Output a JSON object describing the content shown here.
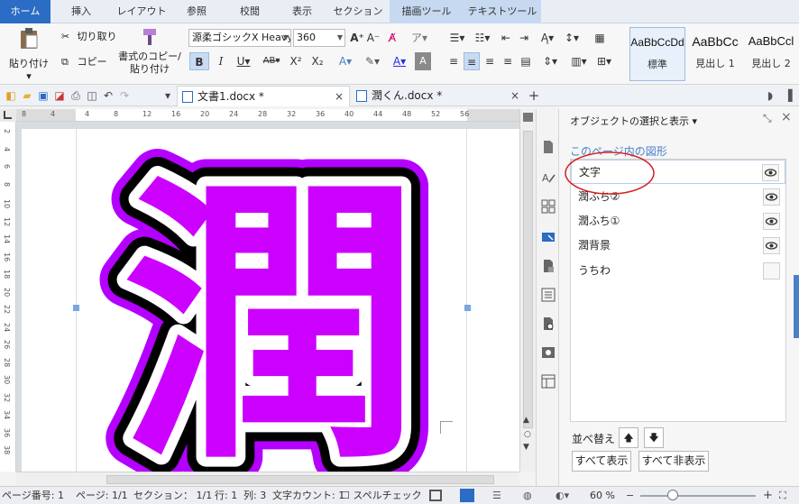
{
  "tabs": [
    {
      "label": "ホーム",
      "active": true
    },
    {
      "label": "挿入"
    },
    {
      "label": "レイアウト"
    },
    {
      "label": "参照"
    },
    {
      "label": "校閲"
    },
    {
      "label": "表示"
    },
    {
      "label": "セクション"
    },
    {
      "label": "描画ツール",
      "contextual": true
    },
    {
      "label": "テキストツール",
      "contextual": true
    }
  ],
  "ribbon": {
    "paste": "貼り付け",
    "cut": "切り取り",
    "copy": "コピー",
    "format_painter_line1": "書式のコピー/",
    "format_painter_line2": "貼り付け",
    "font_name": "源柔ゴシックX Heavy",
    "font_size": "360",
    "styles": [
      {
        "preview": "AaBbCcDd",
        "name": "標準",
        "selected": true
      },
      {
        "preview": "AaBbCc",
        "name": "見出し 1"
      },
      {
        "preview": "AaBbCcl",
        "name": "見出し 2"
      }
    ]
  },
  "doc_tabs": [
    {
      "label": "文書1.docx *",
      "active": true
    },
    {
      "label": "潤くん.docx *"
    }
  ],
  "ruler": {
    "h_labels": [
      "8",
      "4",
      "4",
      "8",
      "12",
      "16",
      "20",
      "24",
      "28",
      "32",
      "36",
      "40",
      "44",
      "48",
      "52",
      "56"
    ],
    "v_labels": [
      "2",
      "4",
      "6",
      "8",
      "10",
      "12",
      "14",
      "16",
      "18",
      "20",
      "22",
      "24",
      "26",
      "28",
      "30",
      "32",
      "34",
      "36",
      "38"
    ]
  },
  "document": {
    "glyph": "潤",
    "fill_color": "#cc00ff",
    "outline_colors": [
      "#ffffff",
      "#000000",
      "#b400ff"
    ]
  },
  "panel": {
    "title": "オブジェクトの選択と表示",
    "section": "このページ内の図形",
    "objects": [
      {
        "name": "文字",
        "visible": true,
        "selected": true
      },
      {
        "name": "潤ふち②",
        "visible": true
      },
      {
        "name": "潤ふち①",
        "visible": true
      },
      {
        "name": "潤背景",
        "visible": true
      },
      {
        "name": "うちわ",
        "visible": false
      }
    ],
    "reorder_label": "並べ替え",
    "show_all": "すべて表示",
    "hide_all": "すべて非表示"
  },
  "status": {
    "page_number": "ページ番号: 1",
    "pages": "ページ: 1/1",
    "section": "セクション： 1/1",
    "row": "行: 1",
    "col": "列: 3",
    "word_count": "文字カウント: 1",
    "spell_check": "スペルチェック",
    "zoom": "60 %"
  }
}
